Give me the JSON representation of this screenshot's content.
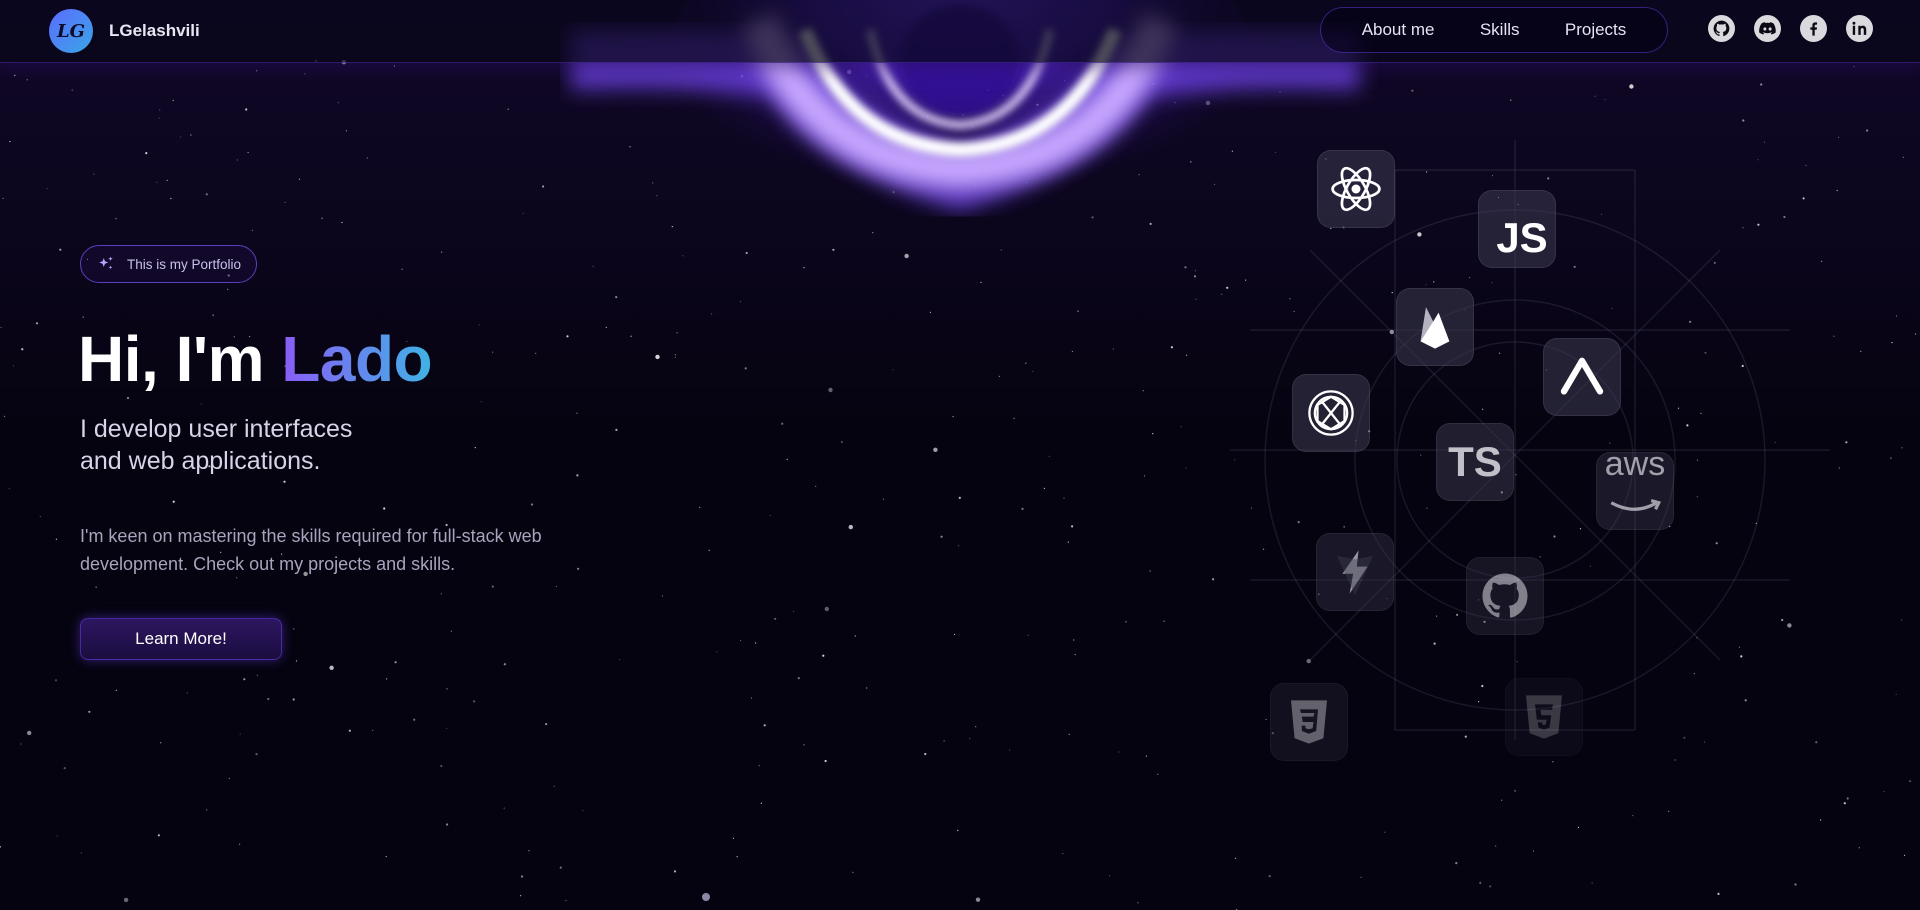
{
  "navbar": {
    "logo_initials": "LG",
    "brand_name": "LGelashvili",
    "links": [
      {
        "label": "About me"
      },
      {
        "label": "Skills"
      },
      {
        "label": "Projects"
      }
    ],
    "socials": [
      {
        "icon": "github-icon"
      },
      {
        "icon": "discord-icon"
      },
      {
        "icon": "facebook-icon"
      },
      {
        "icon": "linkedin-icon"
      }
    ]
  },
  "hero": {
    "badge_text": "This is my Portfolio",
    "greeting": "Hi, I'm",
    "name": "Lado",
    "subtitle_line1": "I develop user interfaces",
    "subtitle_line2": "and web applications.",
    "description": "I'm keen on mastering the skills required for full-stack web development. Check out my projects and skills.",
    "cta_label": "Learn More!"
  },
  "skills": [
    {
      "icon": "react-icon"
    },
    {
      "icon": "javascript-icon",
      "label": "JS"
    },
    {
      "icon": "firebase-icon"
    },
    {
      "icon": "vercel-icon"
    },
    {
      "icon": "openai-icon"
    },
    {
      "icon": "typescript-icon",
      "label": "TS"
    },
    {
      "icon": "aws-icon",
      "label": "aws"
    },
    {
      "icon": "vite-icon"
    },
    {
      "icon": "github-icon"
    },
    {
      "icon": "css3-icon"
    },
    {
      "icon": "html5-icon"
    }
  ],
  "colors": {
    "background": "#05030f",
    "accent_purple": "#7042f8",
    "gradient_start": "#8a5cf6",
    "gradient_end": "#3fb2e5"
  }
}
